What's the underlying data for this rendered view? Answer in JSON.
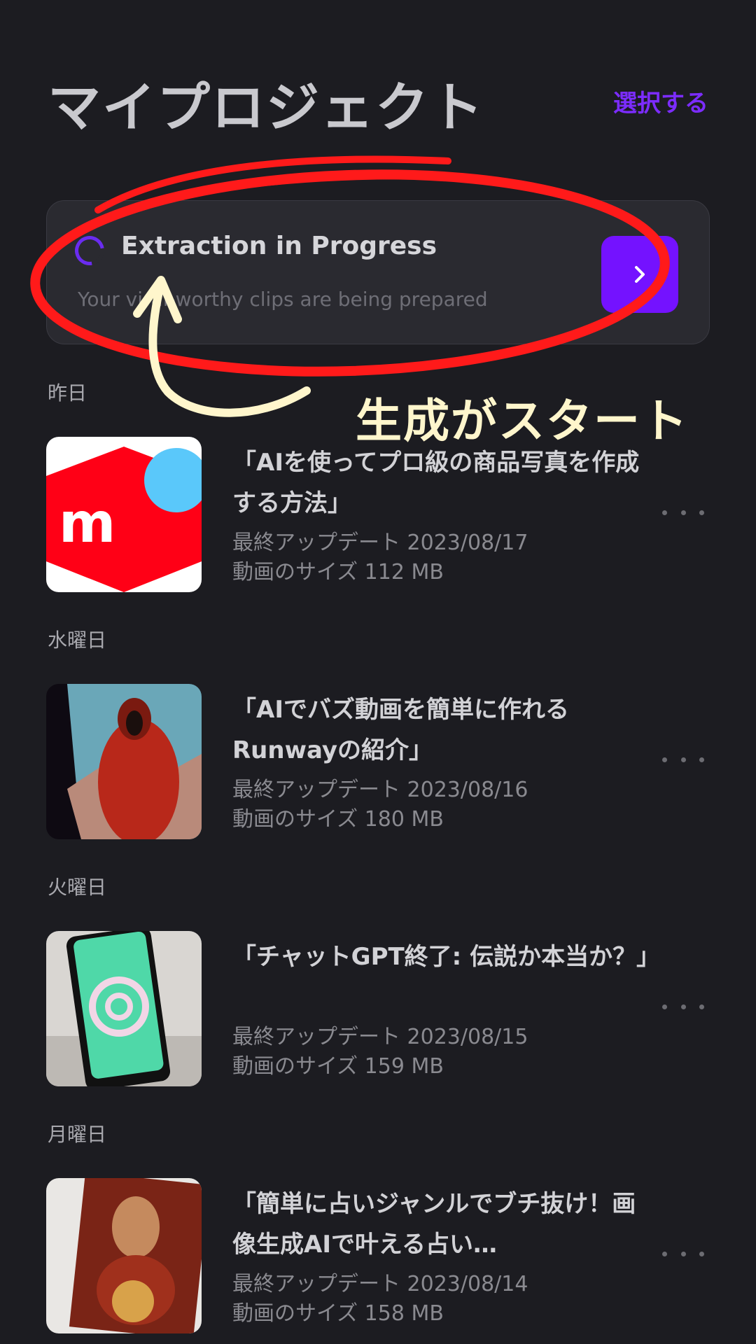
{
  "header": {
    "title": "マイプロジェクト",
    "select_label": "選択する"
  },
  "progress_card": {
    "title": "Extraction in Progress",
    "subtitle": "Your viral-worthy clips are being prepared",
    "icon": "chevron-right-icon",
    "accent": "#7412ff"
  },
  "annotation": {
    "text": "生成がスタート",
    "circle_color": "#ff1a1a",
    "arrow_color": "#fff6cc"
  },
  "sections": [
    {
      "label": "昨日",
      "item": {
        "title": "「AIを使ってプロ級の商品写真を作成する方法」",
        "updated_label": "最終アップデート",
        "updated_value": "2023/08/17",
        "size_label": "動画のサイズ",
        "size_value": "112 MB"
      }
    },
    {
      "label": "水曜日",
      "item": {
        "title": "「AIでバズ動画を簡単に作れるRunwayの紹介」",
        "updated_label": "最終アップデート",
        "updated_value": "2023/08/16",
        "size_label": "動画のサイズ",
        "size_value": "180 MB"
      }
    },
    {
      "label": "火曜日",
      "item": {
        "title": "「チャットGPT終了: 伝説か本当か？」",
        "updated_label": "最終アップデート",
        "updated_value": "2023/08/15",
        "size_label": "動画のサイズ",
        "size_value": "159 MB"
      }
    },
    {
      "label": "月曜日",
      "item": {
        "title": "「簡単に占いジャンルでブチ抜け！画像生成AIで叶える占い…",
        "updated_label": "最終アップデート",
        "updated_value": "2023/08/14",
        "size_label": "動画のサイズ",
        "size_value": "158 MB"
      }
    }
  ]
}
